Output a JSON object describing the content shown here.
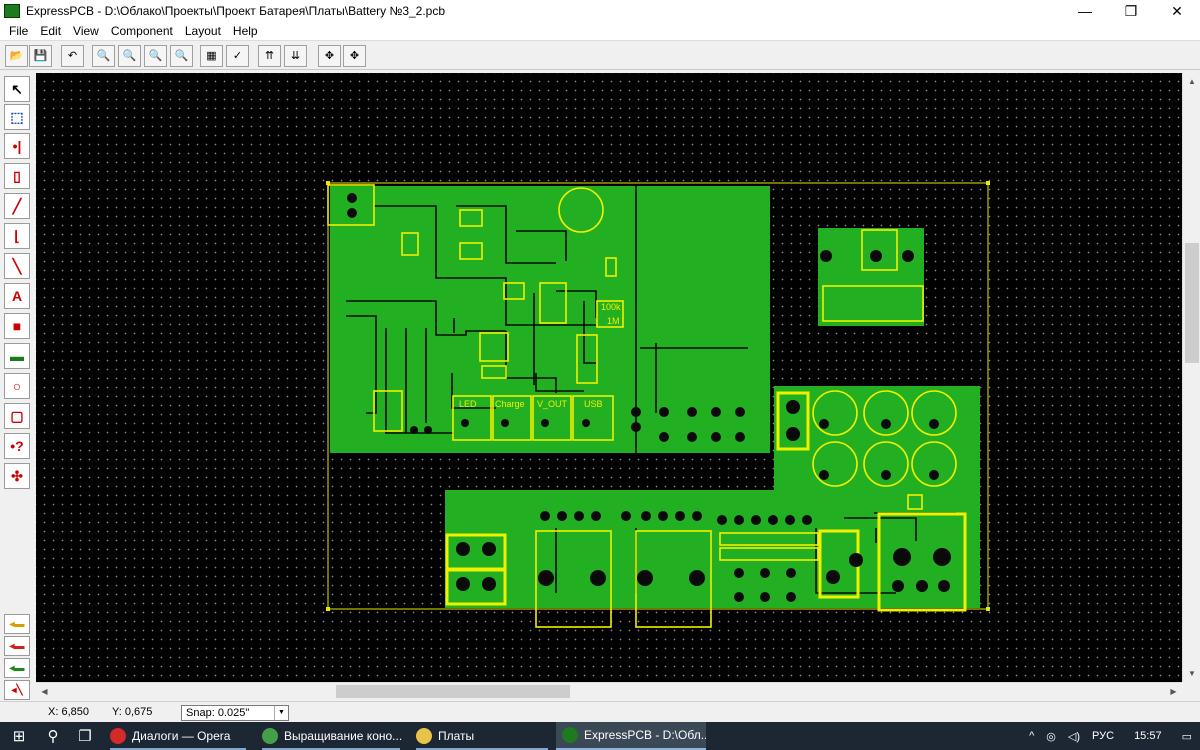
{
  "window": {
    "title": "ExpressPCB - D:\\Облако\\Проекты\\Проект Батарея\\Платы\\Battery №3_2.pcb",
    "controls": {
      "minimize": "—",
      "maximize": "❐",
      "close": "✕"
    }
  },
  "menu": [
    "File",
    "Edit",
    "View",
    "Component",
    "Layout",
    "Help"
  ],
  "toolbar": {
    "buttons": [
      {
        "name": "open-icon",
        "glyph": "📂"
      },
      {
        "name": "save-icon",
        "glyph": "💾"
      },
      {
        "name": "undo-icon",
        "glyph": "↶"
      },
      {
        "name": "zoom-in-icon",
        "glyph": "🔍"
      },
      {
        "name": "zoom-out-icon",
        "glyph": "🔍"
      },
      {
        "name": "zoom-fit-icon",
        "glyph": "🔍"
      },
      {
        "name": "zoom-window-icon",
        "glyph": "🔍"
      },
      {
        "name": "properties-icon",
        "glyph": "▦"
      },
      {
        "name": "check-icon",
        "glyph": "✓"
      },
      {
        "name": "top-layer-icon",
        "glyph": "⇈"
      },
      {
        "name": "bottom-layer-icon",
        "glyph": "⇊"
      },
      {
        "name": "move-icon",
        "glyph": "✥"
      },
      {
        "name": "pan-icon",
        "glyph": "✥"
      }
    ]
  },
  "palette": {
    "tools": [
      {
        "name": "select-tool-icon",
        "glyph": "↖",
        "color": "#000000"
      },
      {
        "name": "zoom-select-tool-icon",
        "glyph": "⬚",
        "color": "#1a50b0"
      },
      {
        "name": "pad-tool-icon",
        "glyph": "•|",
        "color": "#cc0000"
      },
      {
        "name": "component-tool-icon",
        "glyph": "▯",
        "color": "#cc0000"
      },
      {
        "name": "trace-tool-icon",
        "glyph": "╱",
        "color": "#cc0000"
      },
      {
        "name": "corner-tool-icon",
        "glyph": "⌊",
        "color": "#cc0000"
      },
      {
        "name": "diagonal-tool-icon",
        "glyph": "╲",
        "color": "#cc0000"
      },
      {
        "name": "text-tool-icon",
        "glyph": "A",
        "color": "#cc0000"
      },
      {
        "name": "fill-tool-icon",
        "glyph": "■",
        "color": "#cc0000"
      },
      {
        "name": "plane-tool-icon",
        "glyph": "▬",
        "color": "#1a7a1a"
      },
      {
        "name": "circle-tool-icon",
        "glyph": "○",
        "color": "#cc0000"
      },
      {
        "name": "rectangle-tool-icon",
        "glyph": "▢",
        "color": "#cc0000"
      },
      {
        "name": "pad-info-tool-icon",
        "glyph": "•?",
        "color": "#cc0000"
      },
      {
        "name": "netlist-tool-icon",
        "glyph": "✣",
        "color": "#cc0000"
      }
    ],
    "layers": [
      {
        "name": "layer-top-icon",
        "glyph": "◂▬",
        "color": "#d4a000"
      },
      {
        "name": "layer-bottom-icon",
        "glyph": "◂▬",
        "color": "#cc2222"
      },
      {
        "name": "layer-silk-icon",
        "glyph": "◂▬",
        "color": "#1a8a1a"
      },
      {
        "name": "layer-net-icon",
        "glyph": "◂╲",
        "color": "#cc0000"
      }
    ]
  },
  "pcb_labels": {
    "led": "LED",
    "charge": "Charge",
    "vout": "V_OUT",
    "usb": "USB",
    "res_100k": "100k",
    "res_1m": "1M"
  },
  "status": {
    "x": "X: 6,850",
    "y": "Y: 0,675",
    "snap_label": "Snap:",
    "snap_value": "0.025\""
  },
  "taskbar": {
    "tasks": [
      {
        "name": "task-opera",
        "label": "Диалоги — Opera",
        "color": "#d42a2a"
      },
      {
        "name": "task-chrome",
        "label": "Выращивание коно...",
        "color": "#44a047"
      },
      {
        "name": "task-folder",
        "label": "Платы",
        "color": "#e8c34a"
      },
      {
        "name": "task-expresspcb",
        "label": "ExpressPCB - D:\\Обл...",
        "color": "#1e7a1e"
      }
    ],
    "lang": "РУС",
    "time": "15:57"
  }
}
